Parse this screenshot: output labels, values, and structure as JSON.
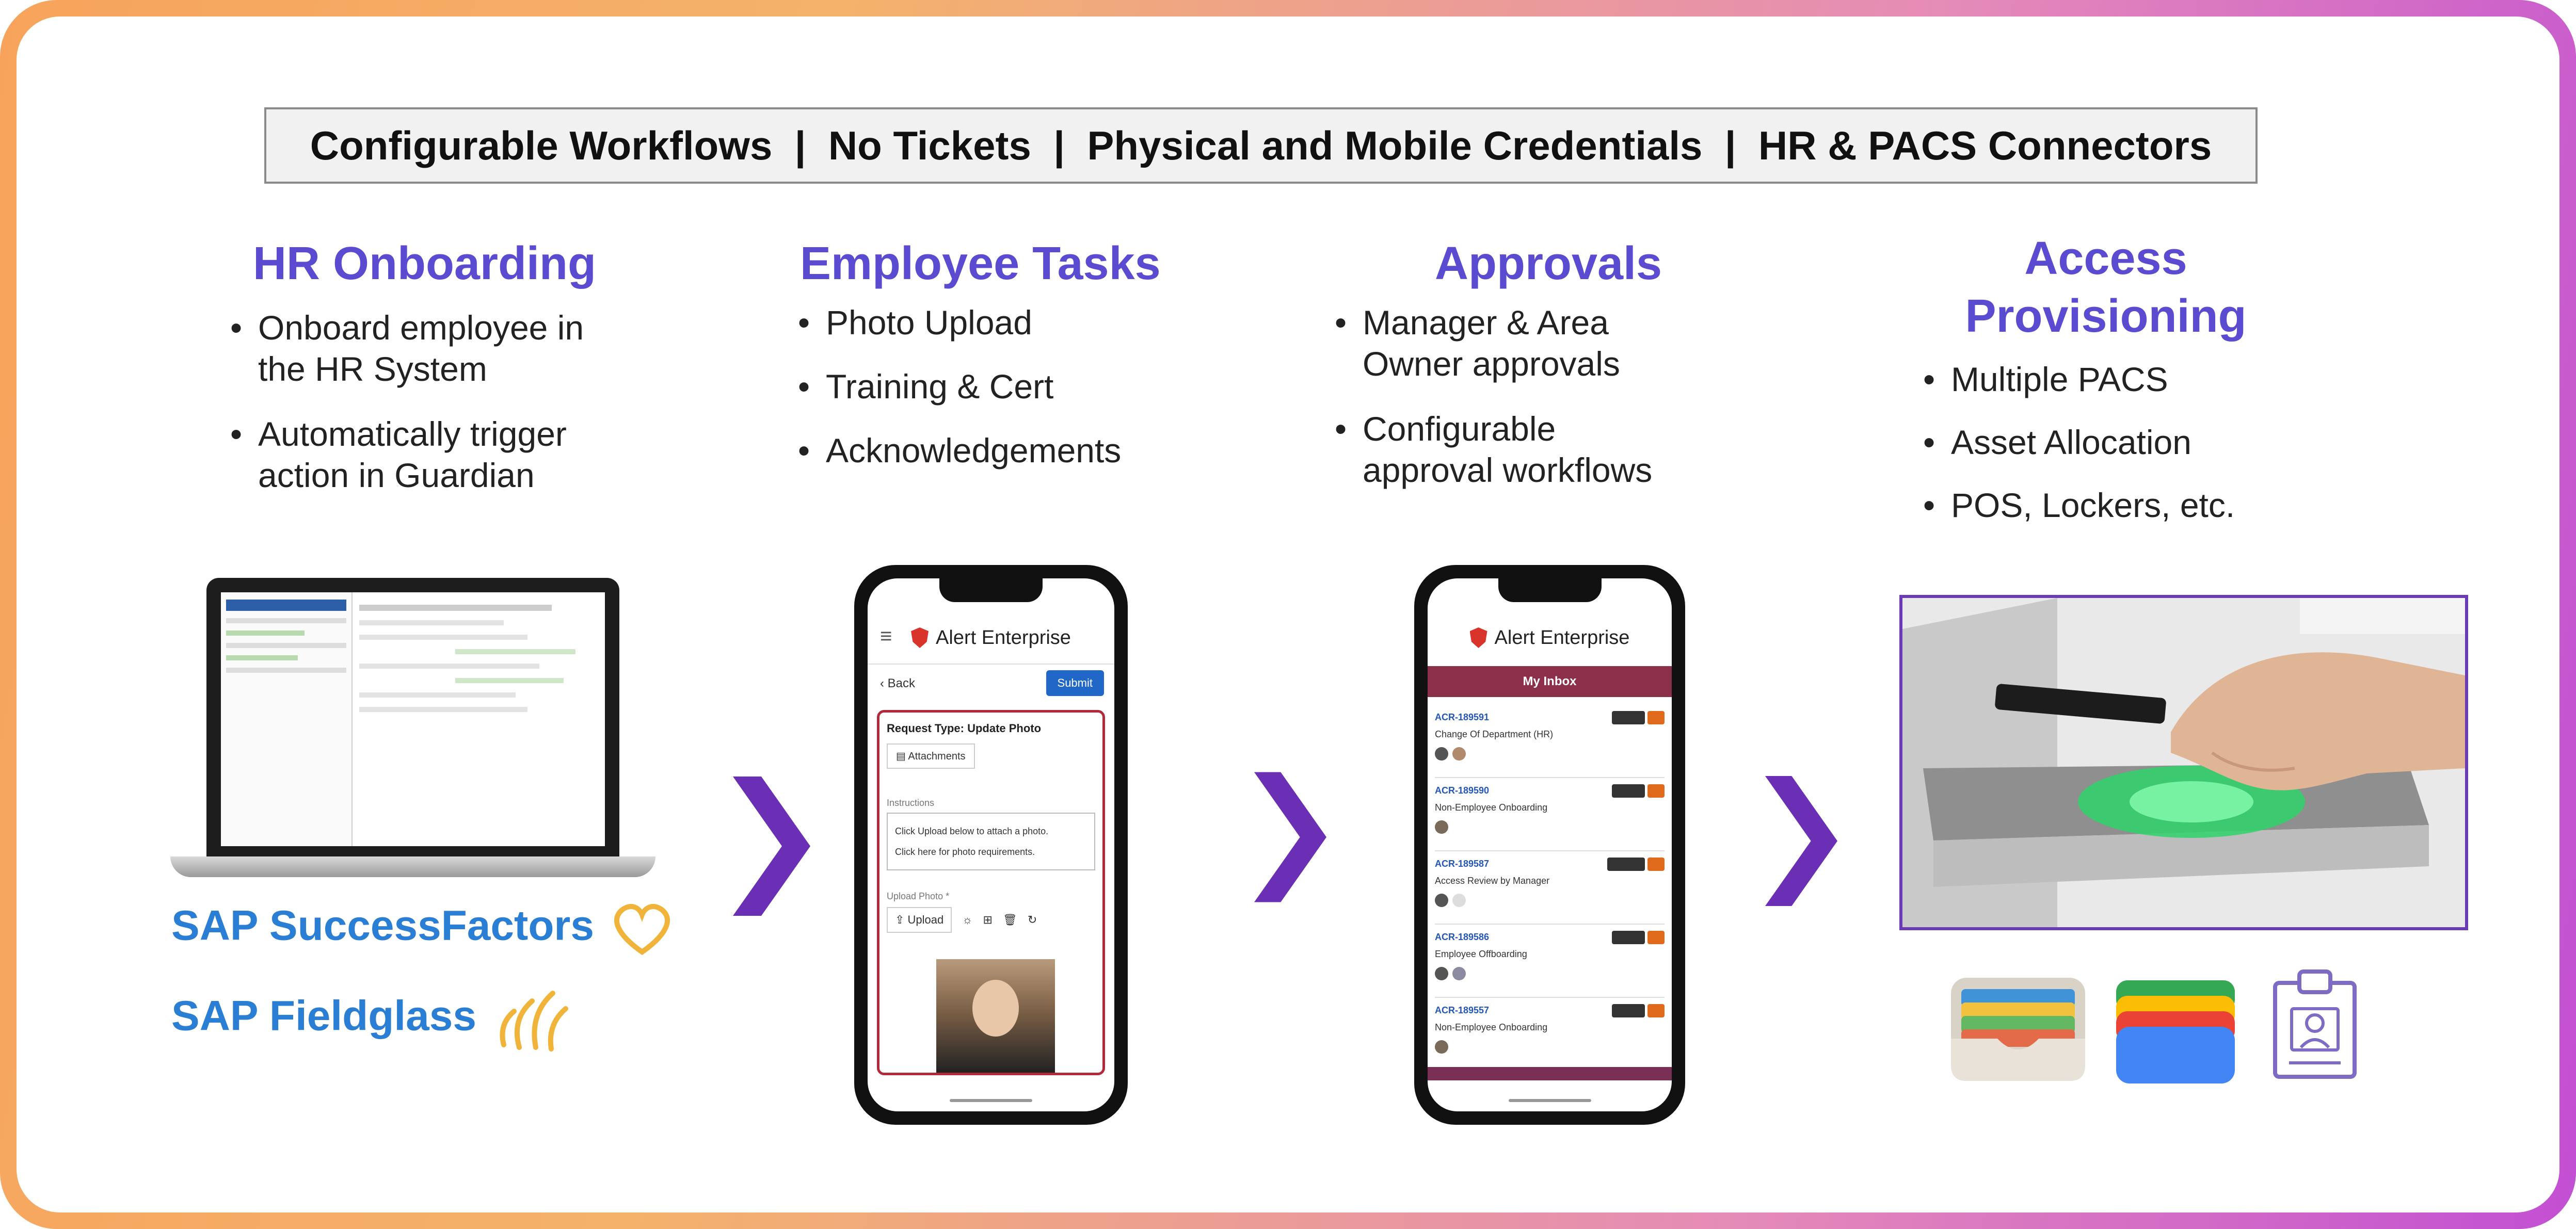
{
  "banner": {
    "text": "Configurable Workflows  |  No Tickets  |  Physical and Mobile Credentials  |  HR & PACS Connectors"
  },
  "columns": [
    {
      "title": "HR Onboarding",
      "bullets": [
        "Onboard employee in the HR System",
        "Automatically trigger action in Guardian"
      ]
    },
    {
      "title": "Employee Tasks",
      "bullets": [
        "Photo Upload",
        "Training & Cert",
        "Acknowledgements"
      ]
    },
    {
      "title": "Approvals",
      "bullets": [
        "Manager & Area Owner approvals",
        "Configurable approval workflows"
      ]
    },
    {
      "title_line1": "Access",
      "title_line2": "Provisioning",
      "bullets": [
        "Multiple PACS",
        "Asset Allocation",
        "POS, Lockers, etc."
      ]
    }
  ],
  "logos": {
    "successfactors": "SAP SuccessFactors",
    "fieldglass": "SAP Fieldglass"
  },
  "phone1": {
    "brand": "Alert Enterprise",
    "back": "Back",
    "submit": "Submit",
    "request_type": "Request Type: Update Photo",
    "attachments": "Attachments",
    "instructions_label": "Instructions",
    "instr_line1": "Click Upload below to attach a photo.",
    "instr_line2": "Click here for photo requirements.",
    "upload_label": "Upload Photo *",
    "upload_button": "Upload"
  },
  "phone2": {
    "brand": "Alert Enterprise",
    "inbox_title": "My Inbox",
    "items": [
      {
        "id": "ACR-189591",
        "title": "Change Of Department (HR)"
      },
      {
        "id": "ACR-189590",
        "title": "Non-Employee Onboarding"
      },
      {
        "id": "ACR-189587",
        "title": "Access Review by Manager"
      },
      {
        "id": "ACR-189586",
        "title": "Employee Offboarding"
      },
      {
        "id": "ACR-189557",
        "title": "Non-Employee Onboarding"
      }
    ]
  },
  "colors": {
    "title_purple": "#5a4bd0",
    "arrow_purple": "#6b2fb5",
    "sap_blue": "#2a7ed4",
    "sap_gold": "#f0b43a",
    "inbox_maroon": "#8b2f4a"
  }
}
